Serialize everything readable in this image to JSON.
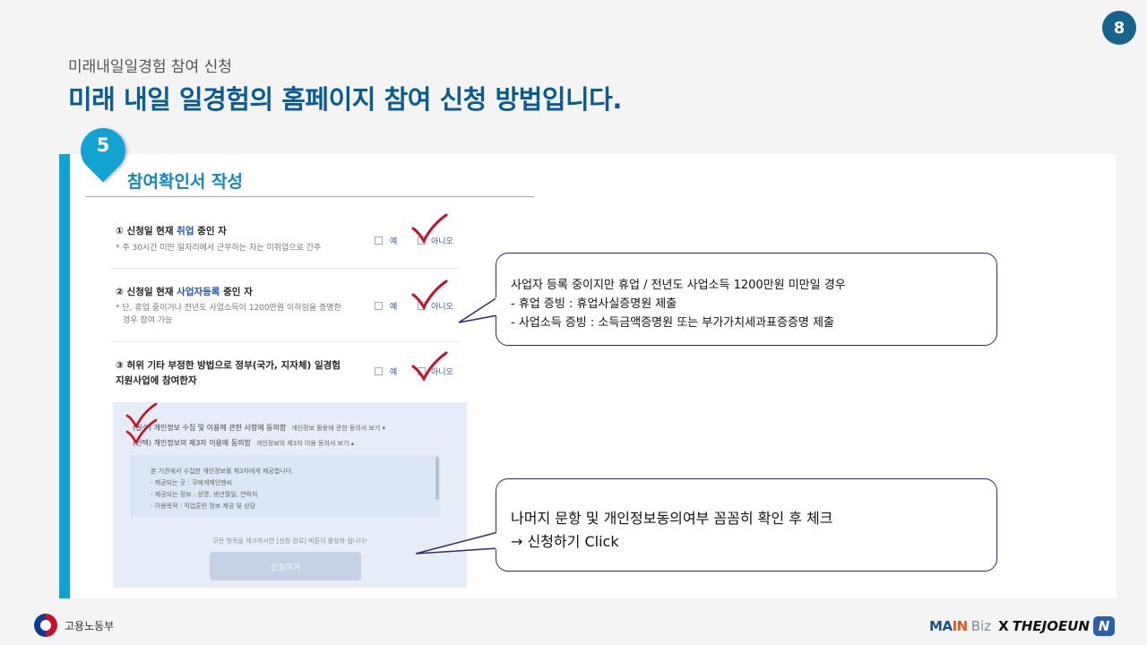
{
  "page_number": "8",
  "header": {
    "subtitle": "미래내일일경험 참여 신청",
    "title": "미래 내일 일경험의 홈페이지 참여 신청 방법입니다."
  },
  "step": {
    "number": "5",
    "heading": "참여확인서 작성"
  },
  "form": {
    "q1": {
      "prefix": "① 신청일 현재 ",
      "highlight": "취업",
      "suffix": " 중인 자",
      "note": "* 주 30시간 미만 일자리에서 근무하는 자는 미취업으로 간주"
    },
    "q2": {
      "prefix": "② 신청일 현재 ",
      "highlight": "사업자등록",
      "suffix": " 중인 자",
      "note_line1": "* 단, 휴업 중이거나 전년도 사업소득이 1200만원 이하임을 증명한",
      "note_line2": "경우 참여 가능"
    },
    "q3": {
      "line1": "③ 허위 기타 부정한 방법으로 정부(국가, 지자체) 일경험",
      "line2": "지원사업에 참여한자"
    },
    "yes_label": "예",
    "no_label": "아니오"
  },
  "agreement": {
    "required_label": "(필수) 개인정보 수집 및 이용에 관한 사항에 동의함",
    "required_link": "개인정보 활용에 관한 동의서 보기 ▾",
    "optional_label": "(선택) 개인정보의 제3자 이용에 동의함",
    "optional_link": "개인정보의 제3자 이용 동의서 보기 ▴",
    "terms": [
      "본 기관에서 수집한 개인정보를 제3자에게 제공합니다.",
      "- 제공되는 곳 : 쿠에게제인맨씨",
      "- 제공되는 정보 : 성명, 생년월일, 연락처",
      "- 이용목적 : 직업훈련 정보 제공 및 상담"
    ],
    "bottom_note": "모든 항목을 체크하시면 [신청 완료] 버튼이 활성화 됩니다!",
    "apply_button": "신청하기"
  },
  "callouts": {
    "first": {
      "heading": "사업자 등록 중이지만 휴업 / 전년도 사업소득 1200만원 미만일 경우",
      "items": [
        "-   휴업 증빙 : 휴업사실증명원 제출",
        "-   사업소득 증빙 : 소득금액증명원 또는 부가가치세과표증증명 제출"
      ]
    },
    "second": {
      "line1": "나머지 문항 및 개인정보동의여부 꼼꼼히 확인 후 체크",
      "line2": "→ 신청하기 Click"
    }
  },
  "footer": {
    "ministry": "고용노동부",
    "brand_main_prefix": "MA",
    "brand_main_in": "IN",
    "brand_biz": "Biz",
    "brand_x": "X",
    "brand_thejoeun": "THEJOEUN",
    "brand_icon": "N"
  },
  "colors": {
    "title_blue": "#0b5b94",
    "accent_cyan": "#13a3d3",
    "check_red": "#c8102e",
    "callout_border": "#2c2c6c"
  },
  "icons": [
    "checkmark-icon",
    "ministry-emblem-icon",
    "brand-logo-icon"
  ]
}
